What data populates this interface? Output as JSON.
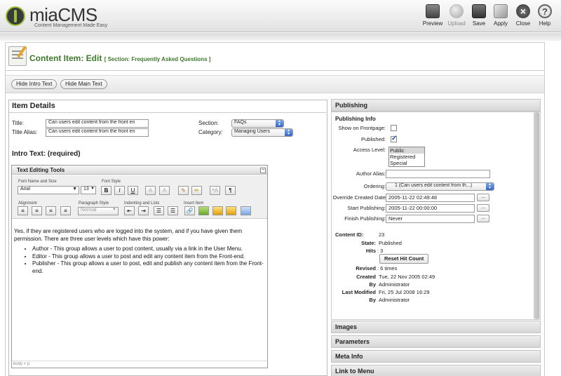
{
  "header": {
    "logo_title": "miaCMS",
    "logo_subtitle": "Content Management Made Easy",
    "toolbar": [
      {
        "label": "Preview",
        "icon": "monitor-icon",
        "enabled": true
      },
      {
        "label": "Upload",
        "icon": "globe-icon",
        "enabled": false
      },
      {
        "label": "Save",
        "icon": "floppy-icon",
        "enabled": true
      },
      {
        "label": "Apply",
        "icon": "apply-icon",
        "enabled": true
      },
      {
        "label": "Close",
        "icon": "close-icon",
        "enabled": true
      },
      {
        "label": "Help",
        "icon": "help-icon",
        "enabled": true
      }
    ]
  },
  "page": {
    "title": "Content Item:",
    "mode": "Edit",
    "section_note": "[ Section: Frequently Asked Questions ]"
  },
  "buttons": {
    "hide_intro": "Hide Intro Text",
    "hide_main": "Hide Main Text"
  },
  "item_details": {
    "heading": "Item Details",
    "title_label": "Title:",
    "title_value": "Can users edit content from the front en",
    "alias_label": "Title Alias:",
    "alias_value": "Can users edit content from the front en",
    "section_label": "Section:",
    "section_value": "FAQs",
    "category_label": "Category:",
    "category_value": "Managing Users",
    "intro_label": "Intro Text: (required)"
  },
  "editor": {
    "title": "Text Editing Tools",
    "minimize": "−",
    "groups": {
      "font_name_size": "Font Name and Size",
      "font_style": "Font Style",
      "alignment": "Alignment",
      "paragraph_style": "Paragraph Style",
      "indenting": "Indenting and Lists",
      "insert_item": "Insert Item"
    },
    "font_name": "Arial",
    "font_size": "13",
    "paragraph_style": "Normal",
    "style_buttons": [
      "B",
      "I",
      "U",
      "A",
      "A"
    ],
    "paragraph": "Yes, if they are registered users who are logged into the system, and if you have given them permission. There are three user levels which have this power:",
    "bullets": [
      "Author - This group allows a user to post content, usually via a link in the User Menu.",
      "Editor - This group allows a user to post and edit any content item from the Front-end.",
      "Publisher - This group allows a user to post, edit and publish any content item from the Front-end."
    ],
    "status_path": "body < p"
  },
  "publishing": {
    "heading": "Publishing",
    "info_heading": "Publishing Info",
    "show_frontpage_label": "Show on Frontpage:",
    "show_frontpage": false,
    "published_label": "Published:",
    "published": true,
    "access_label": "Access Level:",
    "access_options": [
      "Public",
      "Registered",
      "Special"
    ],
    "access_selected": "Public",
    "author_alias_label": "Author Alias:",
    "author_alias_value": "",
    "ordering_label": "Ordering:",
    "ordering_value": "1 (Can users edit content from th...)",
    "override_label": "Override Created Date",
    "override_value": "2005-11-22 02:49:48",
    "start_label": "Start Publishing:",
    "start_value": "2005-11-22 00:00:00",
    "finish_label": "Finish Publishing:",
    "finish_value": "Never",
    "dots": "...",
    "content_id_label": "Content ID:",
    "content_id": "23",
    "state_label": "State:",
    "state": "Published",
    "hits_label": "Hits",
    "hits": ": 3",
    "reset_hits": "Reset Hit Count",
    "revised_label": "Revised",
    "revised": ": 6 times",
    "created_label": "Created",
    "created": "Tue, 22 Nov 2005 02:49",
    "by_label": "By",
    "created_by": "Administrator",
    "last_modified_label": "Last Modified",
    "last_modified": "Fri, 25 Jul 2008 16:29",
    "modified_by": "Administrator"
  },
  "right_sections": [
    "Images",
    "Parameters",
    "Meta Info",
    "Link to Menu"
  ]
}
